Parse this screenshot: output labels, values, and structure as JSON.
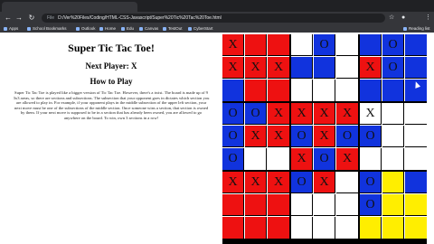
{
  "browser": {
    "url": "D:/Ver%20Files/Coding/HTML-CSS-Javascript/Super%20Tic%20Tac%20Toe.html",
    "url_prefix": "File",
    "bookmarks": [
      "Apps",
      "School Bookmarks",
      "Outlook",
      "Home",
      "Edu",
      "Canvas",
      "TestOut",
      "CyberStart"
    ],
    "reading_list": "Reading list"
  },
  "page": {
    "title": "Super Tic Tac Toe!",
    "next_player": "Next Player: X",
    "how_to": "How to Play",
    "rules": "Super Tic Tac Toe is played like a bigger version of Tic Tac Toe. However, there's a twist. The board is made up of 9 3x3 areas, so there are sections and subsections. The subsection that your opponent goes in dictates which section you are allowed to play in. For example, if your opponent plays in the middle subsection of the upper left section, your next move must be one of the subsections of the middle section. Once someone wins a section, that section is owned by them. If your next move is supposed to be in a section that has already been owned, you are allowed to go anywhere on the board. To win, own 3 sections in a row!"
  },
  "colors": {
    "red": "#ee1111",
    "blue": "#1133dd",
    "yellow": "#ffee00",
    "white": "#ffffff"
  },
  "board": [
    {
      "marks": [
        "X",
        "",
        "",
        "X",
        "X",
        "X",
        "",
        "",
        ""
      ],
      "fills": [
        "R",
        "R",
        "R",
        "R",
        "R",
        "R",
        "B",
        "R",
        "R"
      ]
    },
    {
      "marks": [
        "",
        "O",
        "",
        "",
        "",
        "",
        "",
        "",
        ""
      ],
      "fills": [
        "W",
        "B",
        "W",
        "B",
        "B",
        "W",
        "W",
        "W",
        "W"
      ]
    },
    {
      "marks": [
        "",
        "O",
        "",
        "X",
        "O",
        "",
        "",
        "",
        ""
      ],
      "fills": [
        "B",
        "B",
        "B",
        "R",
        "B",
        "B",
        "B",
        "B",
        "B"
      ]
    },
    {
      "marks": [
        "O",
        "O",
        "X",
        "O",
        "X",
        "X",
        "O",
        "",
        ""
      ],
      "fills": [
        "B",
        "B",
        "R",
        "B",
        "R",
        "R",
        "B",
        "W",
        "W"
      ]
    },
    {
      "marks": [
        "X",
        "X",
        "X",
        "O",
        "X",
        "O",
        "X",
        "O",
        "X"
      ],
      "fills": [
        "R",
        "R",
        "R",
        "B",
        "R",
        "B",
        "R",
        "B",
        "R"
      ]
    },
    {
      "marks": [
        "X",
        "",
        "",
        "O",
        "",
        "",
        "",
        "",
        ""
      ],
      "fills": [
        "W",
        "W",
        "W",
        "B",
        "W",
        "W",
        "W",
        "W",
        "W"
      ]
    },
    {
      "marks": [
        "X",
        "X",
        "X",
        "",
        "",
        "",
        "",
        "",
        ""
      ],
      "fills": [
        "R",
        "R",
        "R",
        "R",
        "R",
        "R",
        "R",
        "R",
        "R"
      ]
    },
    {
      "marks": [
        "O",
        "X",
        "",
        "",
        "",
        "",
        "",
        "",
        ""
      ],
      "fills": [
        "B",
        "R",
        "W",
        "W",
        "W",
        "W",
        "W",
        "W",
        "W"
      ]
    },
    {
      "marks": [
        "O",
        "",
        "",
        "O",
        "",
        "",
        "",
        "",
        ""
      ],
      "fills": [
        "B",
        "Y",
        "B",
        "B",
        "Y",
        "Y",
        "Y",
        "Y",
        "Y"
      ]
    }
  ]
}
